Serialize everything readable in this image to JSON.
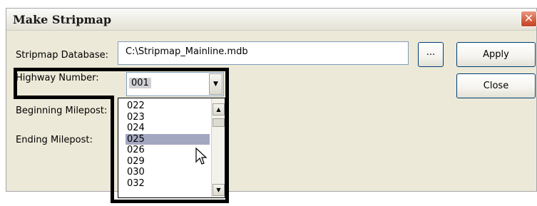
{
  "window": {
    "title": "Make Stripmap",
    "close_glyph": "✕"
  },
  "form": {
    "database_label": "Stripmap Database:",
    "database_value": "C:\\Stripmap_Mainline.mdb",
    "browse_label": "...",
    "highway_label": "Highway Number:",
    "highway_value": "001",
    "beginning_label": "Beginning Milepost:",
    "ending_label": "Ending Milepost:"
  },
  "buttons": {
    "apply": "Apply",
    "close": "Close"
  },
  "dropdown": {
    "items": [
      "022",
      "023",
      "024",
      "025",
      "026",
      "029",
      "030",
      "032"
    ],
    "highlighted": "025"
  },
  "icons": {
    "combo_arrow": "▼",
    "scroll_up": "▲",
    "scroll_down": "▼",
    "cursor": "mouse-pointer-icon"
  },
  "colors": {
    "dialog_bg": "#ece9d8",
    "selection": "#a4a7c0",
    "close_button": "#d65d3e",
    "annotation_border": "#000000"
  }
}
